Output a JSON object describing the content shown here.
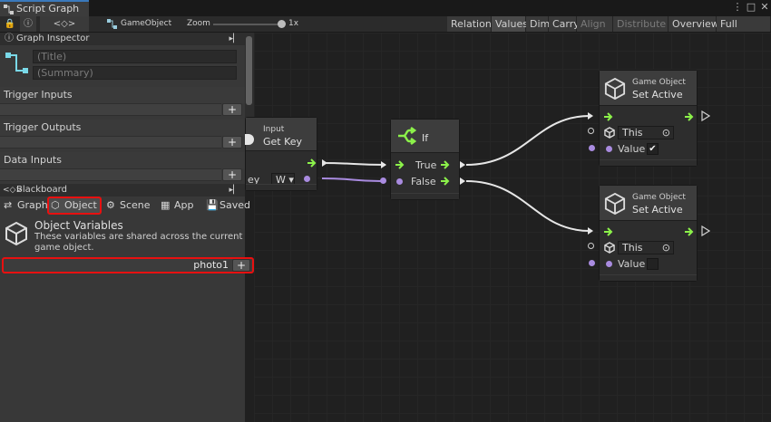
{
  "window": {
    "title": "Script Graph"
  },
  "toolbar": {
    "graph_target": "GameObject",
    "zoom_label": "Zoom",
    "zoom_value": "1x",
    "buttons": [
      "Relations",
      "Values",
      "Dim",
      "Carry",
      "Align ▾",
      "Distribute ▾",
      "Overview",
      "Full Screen"
    ]
  },
  "inspector": {
    "header": "Graph Inspector",
    "title_placeholder": "(Title)",
    "summary_placeholder": "(Summary)",
    "sections": [
      "Trigger Inputs",
      "Trigger Outputs",
      "Data Inputs"
    ]
  },
  "blackboard": {
    "header": "Blackboard",
    "tabs": [
      "Graph",
      "Object",
      "Scene",
      "App",
      "Saved"
    ],
    "heading": "Object Variables",
    "description_line1": "These variables are shared across the current",
    "description_line2": "game object.",
    "new_variable_value": "photo1"
  },
  "nodes": {
    "get_key": {
      "subtitle": "Input",
      "title": "Get Key",
      "port_label": "ey",
      "key_value": "W"
    },
    "if": {
      "title": "If",
      "true_label": "True",
      "false_label": "False"
    },
    "set_active_top": {
      "subtitle": "Game Object",
      "title": "Set Active",
      "target_value": "This",
      "value_label": "Value",
      "checked": "✔"
    },
    "set_active_bottom": {
      "subtitle": "Game Object",
      "title": "Set Active",
      "target_value": "This",
      "value_label": "Value"
    }
  },
  "colors": {
    "accent": "#3a79bb",
    "highlight": "#e81010",
    "flow_arrow": "#8cf24a",
    "data_port": "#a98be0"
  }
}
